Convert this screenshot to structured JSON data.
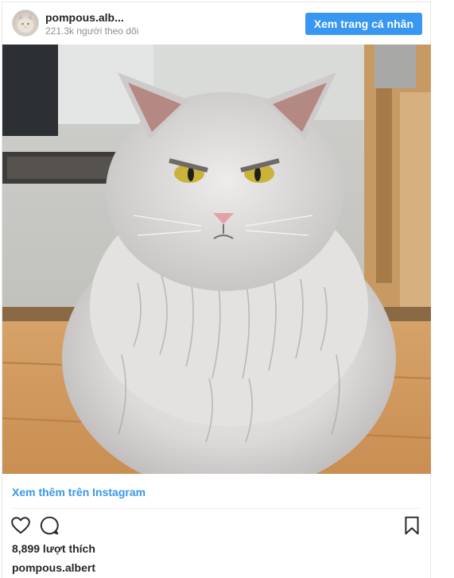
{
  "header": {
    "username": "pompous.alb...",
    "followers": "221.3k người theo dõi",
    "view_profile_label": "Xem trang cá nhân",
    "accent_color": "#3897f0"
  },
  "post": {
    "image_subject": "grumpy curly-haired grey cat sitting on wooden floor",
    "more_link_label": "Xem thêm trên Instagram",
    "likes": "8,899 lượt thích",
    "caption_username": "pompous.albert"
  },
  "actions": {
    "icons": [
      "heart-icon",
      "comment-icon",
      "bookmark-icon"
    ]
  }
}
